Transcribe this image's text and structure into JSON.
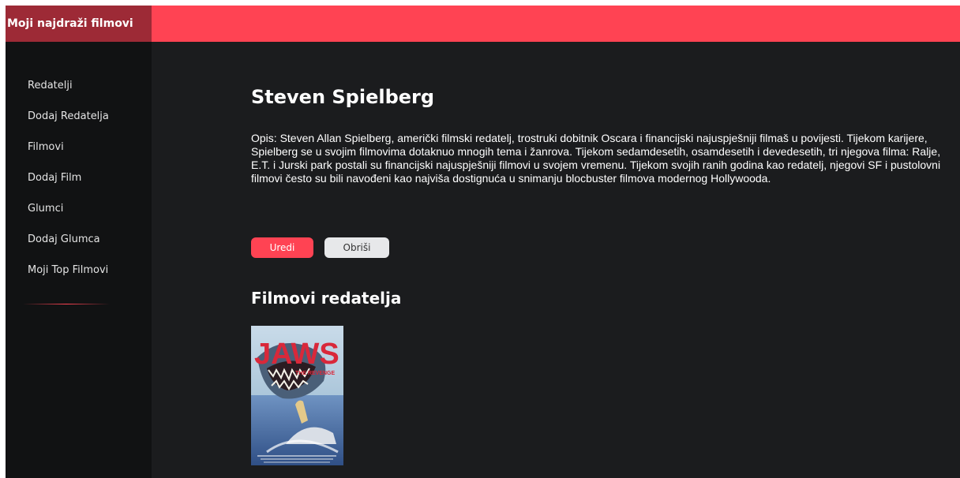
{
  "header": {
    "brand": "Moji najdraži filmovi",
    "accent_color": "#ff4353",
    "brand_bg": "#9d2a36"
  },
  "sidebar": {
    "items": [
      {
        "label": "Redatelji"
      },
      {
        "label": "Dodaj Redatelja"
      },
      {
        "label": "Filmovi"
      },
      {
        "label": "Dodaj Film"
      },
      {
        "label": "Glumci"
      },
      {
        "label": "Dodaj Glumca"
      },
      {
        "label": "Moji Top Filmovi"
      }
    ]
  },
  "director": {
    "name": "Steven Spielberg",
    "description": "Opis: Steven Allan Spielberg, američki filmski redatelj, trostruki dobitnik Oscara i financijski najuspješniji filmaš u povijesti. Tijekom karijere, Spielberg se u svojim filmovima dotaknuo mnogih tema i žanrova. Tijekom sedamdesetih, osamdesetih i devedesetih, tri njegova filma: Ralje, E.T. i Jurski park postali su financijski najuspješniji filmovi u svojem vremenu. Tijekom svojih ranih godina kao redatelj, njegovi SF i pustolovni filmovi često su bili navođeni kao najviša dostignuća u snimanju blocbuster filmova modernog Hollywooda."
  },
  "actions": {
    "edit_label": "Uredi",
    "delete_label": "Obriši"
  },
  "films_section": {
    "title": "Filmovi redatelja",
    "films": [
      {
        "poster_title": "JAWS",
        "poster_subtitle": "THE REVENGE"
      }
    ]
  }
}
